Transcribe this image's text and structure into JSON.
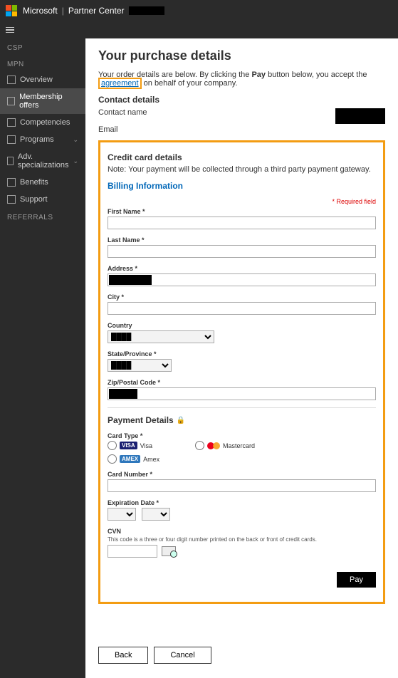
{
  "header": {
    "brand": "Microsoft",
    "product": "Partner Center"
  },
  "sidebar": {
    "sections": {
      "csp": "CSP",
      "mpn": "MPN",
      "referrals": "REFERRALS"
    },
    "items": {
      "overview": "Overview",
      "membership": "Membership offers",
      "competencies": "Competencies",
      "programs": "Programs",
      "advspec": "Adv. specializations",
      "benefits": "Benefits",
      "support": "Support"
    }
  },
  "page": {
    "title": "Your purchase details",
    "intro_pre": "Your order details are below. By clicking the ",
    "intro_pay": "Pay",
    "intro_mid": " button below, you accept the ",
    "intro_link": "agreement",
    "intro_post": " on behalf of your company.",
    "contact_heading": "Contact details",
    "contact_name_label": "Contact name",
    "contact_email_label": "Email"
  },
  "cc": {
    "heading": "Credit card details",
    "note": "Note: Your payment will be collected through a third party payment gateway.",
    "billing_heading": "Billing Information",
    "required": "* Required field",
    "first_name": "First Name *",
    "last_name": "Last Name *",
    "address": "Address *",
    "city": "City *",
    "country": "Country",
    "state": "State/Province *",
    "zip": "Zip/Postal Code *",
    "payment_heading": "Payment Details",
    "card_type": "Card Type *",
    "visa": "Visa",
    "mastercard": "Mastercard",
    "amex": "Amex",
    "visa_badge": "VISA",
    "amex_badge": "AMEX",
    "card_number": "Card Number *",
    "exp": "Expiration Date *",
    "cvn": "CVN",
    "cvn_desc": "This code is a three or four digit number printed on the back or front of credit cards.",
    "pay": "Pay"
  },
  "footer": {
    "back": "Back",
    "cancel": "Cancel"
  }
}
